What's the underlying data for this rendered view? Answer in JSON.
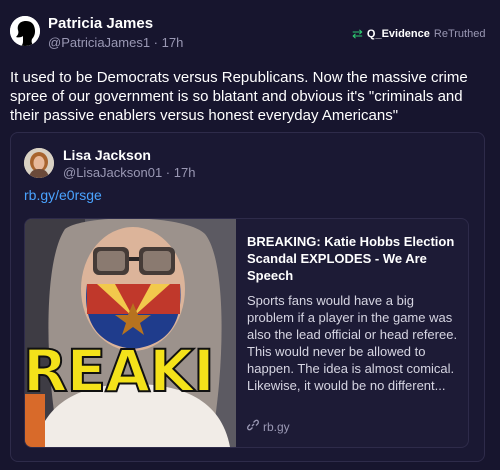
{
  "post": {
    "author_name": "Patricia James",
    "author_handle": "@PatriciaJames1 · 17h",
    "retruth_user": "Q_Evidence",
    "retruth_label": "ReTruthed",
    "text": "It used to be Democrats versus Republicans. Now the massive crime spree of our government is so blatant and obvious it's \"criminals and their passive enablers versus honest everyday Americans\""
  },
  "quote": {
    "author_name": "Lisa Jackson",
    "author_handle": "@LisaJackson01 · 17h",
    "link_text": "rb.gy/e0rsge",
    "card": {
      "image_caption": "REAKI",
      "title": "BREAKING: Katie Hobbs Election Scandal EXPLODES - We Are Speech",
      "description": "Sports fans would have a big problem if a player in the game was also the lead official or head referee. This would never be allowed to happen. The idea is almost comical. Likewise, it would be no different...",
      "domain": "rb.gy"
    }
  },
  "colors": {
    "background": "#17152e",
    "card_border": "#2e2b4a",
    "link": "#4aa3ff",
    "retruth_icon": "#2ecc71",
    "muted_text": "#9a98b4"
  },
  "icons": {
    "retruth": "retruth-icon",
    "link": "link-icon"
  }
}
